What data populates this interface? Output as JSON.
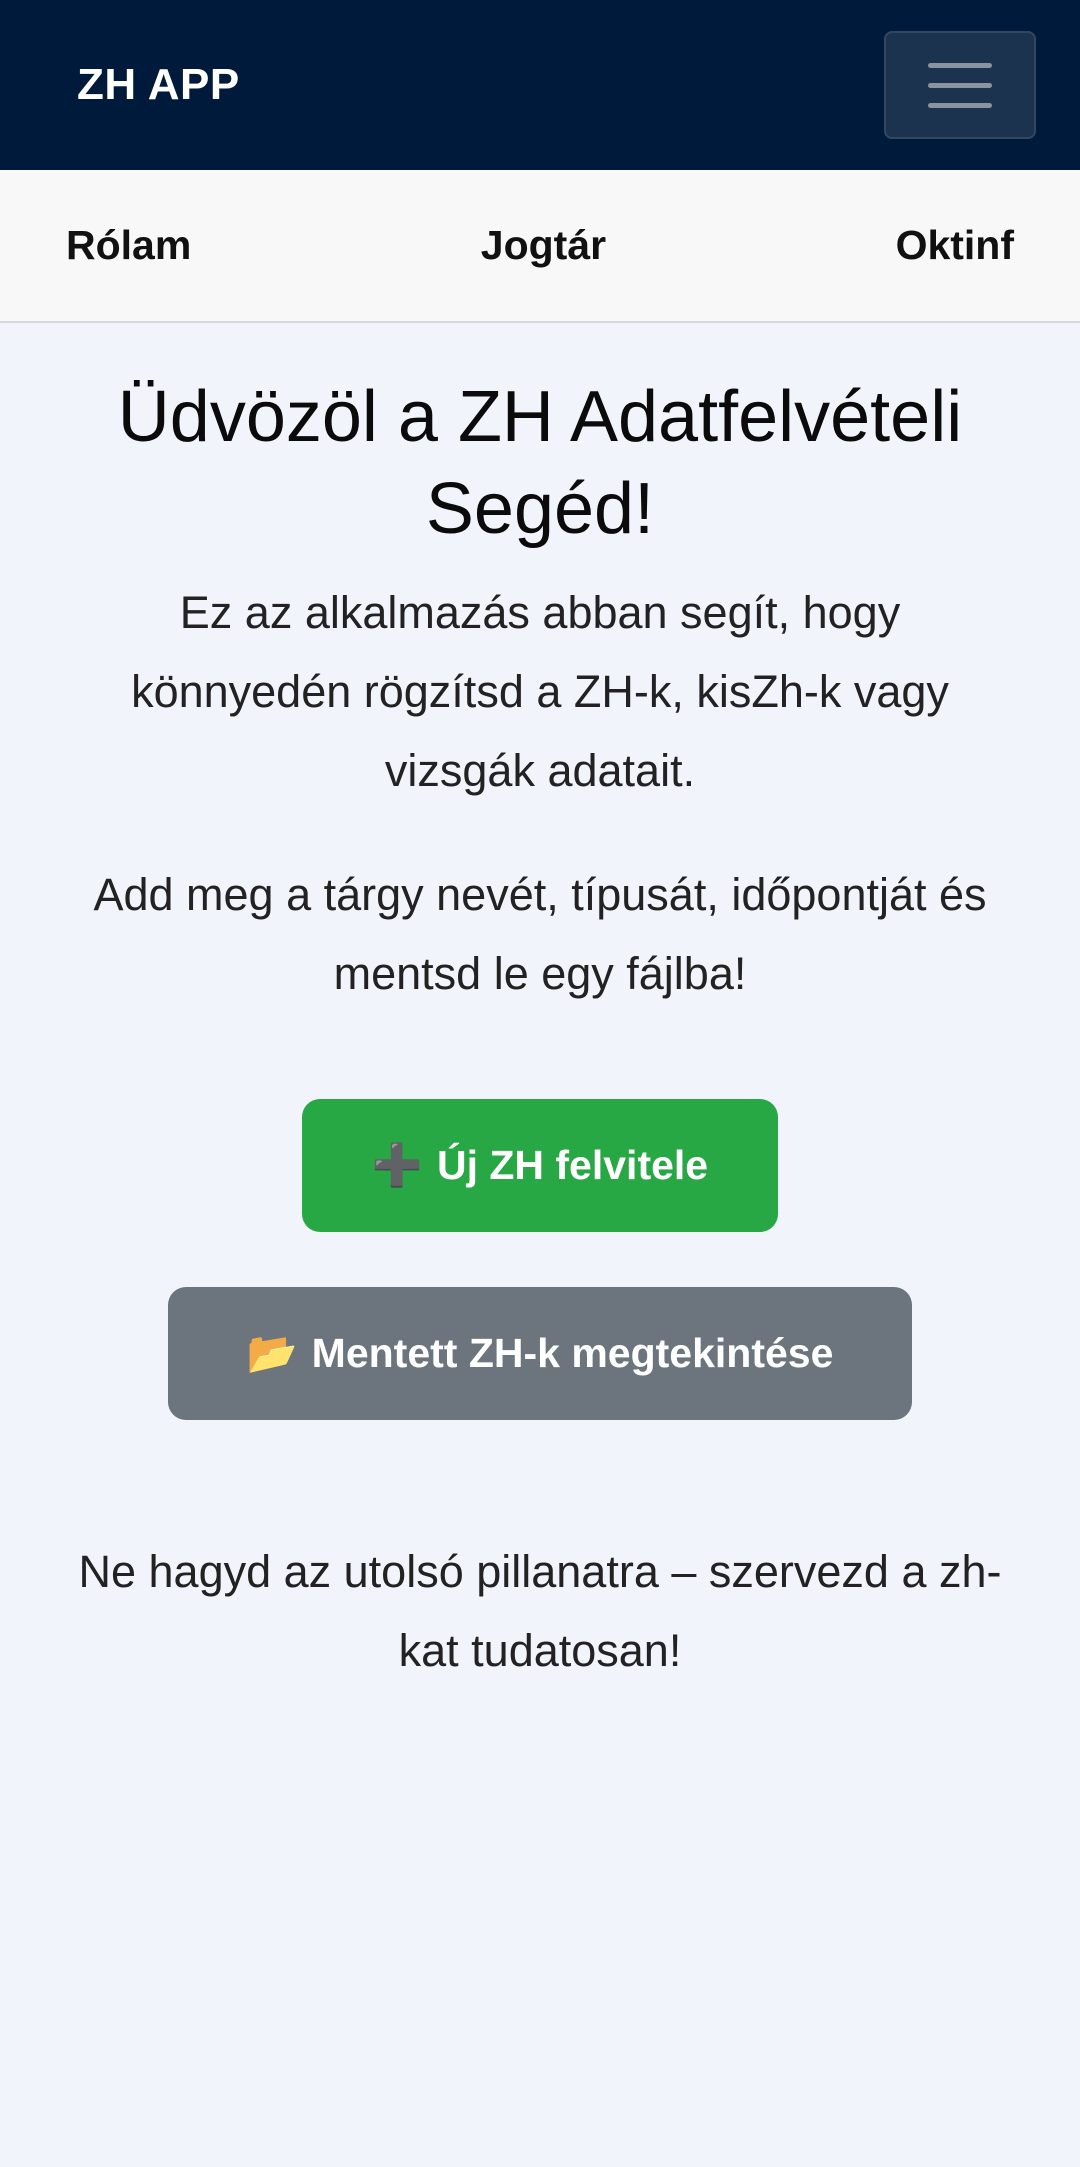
{
  "navbar": {
    "brand": "ZH APP",
    "menu_icon": "hamburger-menu-icon"
  },
  "subnav": {
    "items": [
      {
        "label": "Rólam"
      },
      {
        "label": "Jogtár"
      },
      {
        "label": "Oktinf"
      }
    ]
  },
  "main": {
    "title": "Üdvözöl a ZH Adatfelvételi Segéd!",
    "intro": "Ez az alkalmazás abban segít, hogy könnyedén rögzítsd a ZH-k, kisZh-k vagy vizsgák adatait.",
    "instruction": "Add meg a tárgy nevét, típusát, időpontját és mentsd le egy fájlba!",
    "new_button": {
      "icon": "➕",
      "label": "Új ZH felvitele"
    },
    "saved_button": {
      "icon": "📂",
      "label": "Mentett ZH-k megtekintése"
    },
    "footer": "Ne hagyd az utolsó pillanatra – szervezd a zh-kat tudatosan!"
  },
  "colors": {
    "navbar": "#001a3b",
    "primary_button": "#28a745",
    "secondary_button": "#6c757d",
    "background": "#f1f5fb"
  }
}
